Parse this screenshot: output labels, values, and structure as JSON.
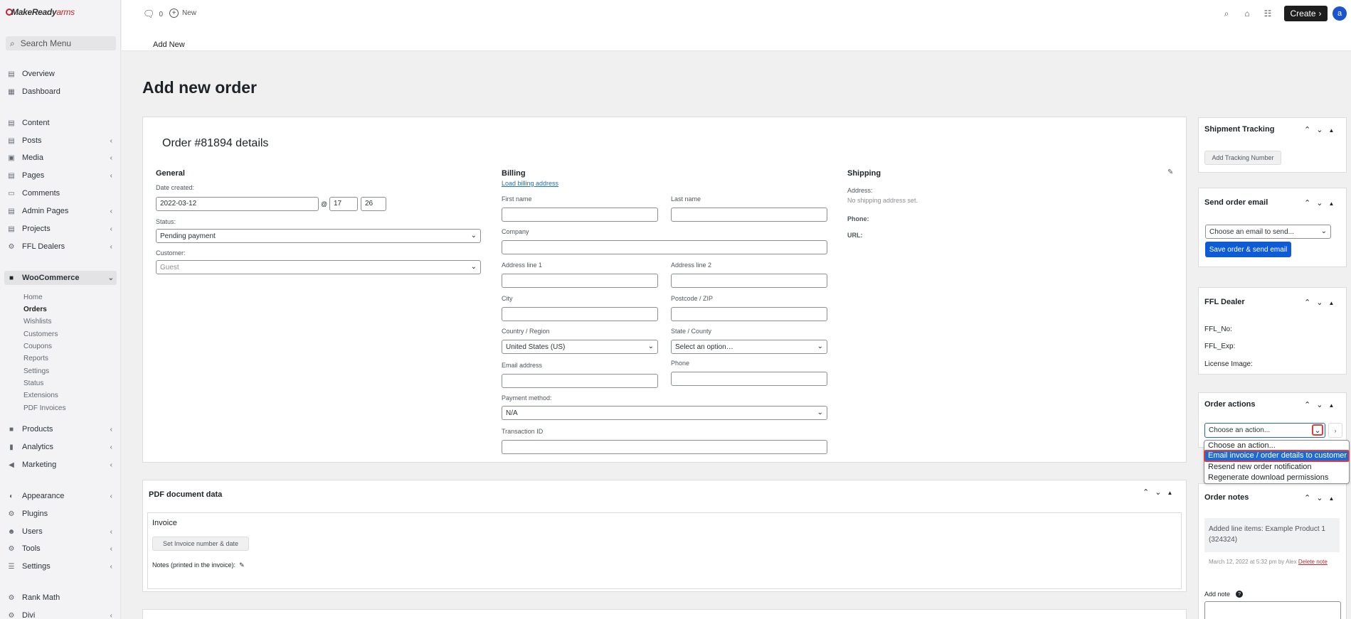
{
  "brand": {
    "logo_main": "MakeReady",
    "logo_accent": "arms"
  },
  "sidebar": {
    "search_placeholder": "Search Menu",
    "items": [
      {
        "label": "Overview",
        "icon": "overview-icon"
      },
      {
        "label": "Dashboard",
        "icon": "dashboard-icon"
      },
      {
        "label": "Content",
        "icon": "content-icon"
      },
      {
        "label": "Posts",
        "icon": "posts-icon"
      },
      {
        "label": "Media",
        "icon": "media-icon"
      },
      {
        "label": "Pages",
        "icon": "pages-icon"
      },
      {
        "label": "Comments",
        "icon": "comments-icon"
      },
      {
        "label": "Admin Pages",
        "icon": "admin-pages-icon"
      },
      {
        "label": "Projects",
        "icon": "projects-icon"
      },
      {
        "label": "FFL Dealers",
        "icon": "ffl-dealers-icon"
      },
      {
        "label": "WooCommerce",
        "icon": "woocommerce-icon"
      },
      {
        "label": "Products",
        "icon": "products-icon"
      },
      {
        "label": "Analytics",
        "icon": "analytics-icon"
      },
      {
        "label": "Marketing",
        "icon": "marketing-icon"
      },
      {
        "label": "Appearance",
        "icon": "appearance-icon"
      },
      {
        "label": "Plugins",
        "icon": "plugins-icon"
      },
      {
        "label": "Users",
        "icon": "users-icon"
      },
      {
        "label": "Tools",
        "icon": "tools-icon"
      },
      {
        "label": "Settings",
        "icon": "settings-icon"
      },
      {
        "label": "Rank Math",
        "icon": "rank-math-icon"
      },
      {
        "label": "Divi",
        "icon": "divi-icon"
      }
    ],
    "woo_submenu": [
      "Home",
      "Orders",
      "Wishlists",
      "Customers",
      "Coupons",
      "Reports",
      "Settings",
      "Status",
      "Extensions",
      "PDF Invoices"
    ]
  },
  "topbar": {
    "comment_count": "0",
    "new_label": "New",
    "create_label": "Create",
    "avatar_initial": "a"
  },
  "subheader": {
    "add_new": "Add New"
  },
  "page": {
    "title": "Add new order"
  },
  "order": {
    "heading": "Order #81894 details",
    "general": {
      "title": "General",
      "date_label": "Date created:",
      "date_value": "2022-03-12",
      "at": "@",
      "hour": "17",
      "minute": "26",
      "status_label": "Status:",
      "status_value": "Pending payment",
      "customer_label": "Customer:",
      "customer_value": "Guest"
    },
    "billing": {
      "title": "Billing",
      "load_link": "Load billing address",
      "first_name": "First name",
      "last_name": "Last name",
      "company": "Company",
      "address1": "Address line 1",
      "address2": "Address line 2",
      "city": "City",
      "postcode": "Postcode / ZIP",
      "country_label": "Country / Region",
      "country_value": "United States (US)",
      "state_label": "State / County",
      "state_value": "Select an option…",
      "email": "Email address",
      "phone": "Phone",
      "payment_label": "Payment method:",
      "payment_value": "N/A",
      "transaction": "Transaction ID"
    },
    "shipping": {
      "title": "Shipping",
      "address_label": "Address:",
      "address_value": "No shipping address set.",
      "phone_label": "Phone:",
      "url_label": "URL:"
    }
  },
  "pdf": {
    "title": "PDF document data",
    "invoice_title": "Invoice",
    "set_button": "Set Invoice number & date",
    "notes_label": "Notes (printed in the invoice):"
  },
  "right": {
    "shipment": {
      "title": "Shipment Tracking",
      "button": "Add Tracking Number"
    },
    "send_email": {
      "title": "Send order email",
      "select": "Choose an email to send...",
      "button": "Save order & send email"
    },
    "ffl": {
      "title": "FFL Dealer",
      "no": "FFL_No:",
      "exp": "FFL_Exp:",
      "license": "License Image:"
    },
    "actions": {
      "title": "Order actions",
      "select": "Choose an action...",
      "options": [
        "Choose an action...",
        "Email invoice / order details to customer",
        "Resend new order notification",
        "Regenerate download permissions"
      ]
    },
    "notes": {
      "title": "Order notes",
      "note_text": "Added line items: Example Product 1 (324324)",
      "note_meta": "March 12, 2022 at 5:32 pm by Alex",
      "delete": "Delete note",
      "add_note": "Add note"
    }
  },
  "colors": {
    "accent": "#0d5cd6",
    "highlight_outline": "#e23b3b",
    "brand_red": "#c0272d"
  }
}
